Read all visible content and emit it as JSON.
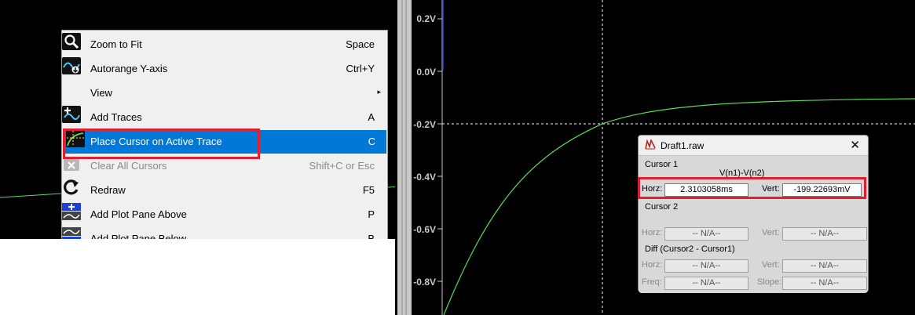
{
  "context_menu": {
    "items": [
      {
        "label": "Zoom to Fit",
        "shortcut": "Space",
        "icon": "zoom-to-fit-icon"
      },
      {
        "label": "Autorange Y-axis",
        "shortcut": "Ctrl+Y",
        "icon": "autorange-icon"
      },
      {
        "label": "View",
        "shortcut": "",
        "icon": ""
      },
      {
        "label": "Add Traces",
        "shortcut": "A",
        "icon": "add-traces-icon"
      },
      {
        "label": "Place Cursor on Active Trace",
        "shortcut": "C",
        "icon": "place-cursor-icon"
      },
      {
        "label": "Clear All Cursors",
        "shortcut": "Shift+C or Esc",
        "icon": "clear-cursors-icon"
      },
      {
        "label": "Redraw",
        "shortcut": "F5",
        "icon": "redraw-icon"
      },
      {
        "label": "Add Plot Pane Above",
        "shortcut": "P",
        "icon": "add-pane-above-icon"
      },
      {
        "label": "Add Plot Pane Below",
        "shortcut": "B",
        "icon": "add-pane-below-icon"
      }
    ],
    "submenu_arrow": "▸"
  },
  "plot": {
    "y_ticks": [
      "0.2V",
      "0.0V",
      "-0.2V",
      "-0.4V",
      "-0.6V",
      "-0.8V"
    ],
    "trace_color": "#5adc5a"
  },
  "cursor_dialog": {
    "title": "Draft1.raw",
    "close": "✕",
    "cursor1_label": "Cursor 1",
    "trace_name": "V(n1)-V(n2)",
    "horz_label": "Horz:",
    "vert_label": "Vert:",
    "horz_value": "2.3103058ms",
    "vert_value": "-199.22693mV",
    "cursor2_label": "Cursor 2",
    "c2_horz": "-- N/A--",
    "c2_vert": "-- N/A--",
    "diff_label": "Diff (Cursor2 - Cursor1)",
    "diff_horz": "-- N/A--",
    "diff_vert": "-- N/A--",
    "freq_label": "Freq:",
    "slope_label": "Slope:",
    "diff_freq": "-- N/A--",
    "diff_slope": "-- N/A--"
  },
  "colors": {
    "highlight": "#0078d7",
    "annotation_red": "#e02030"
  }
}
